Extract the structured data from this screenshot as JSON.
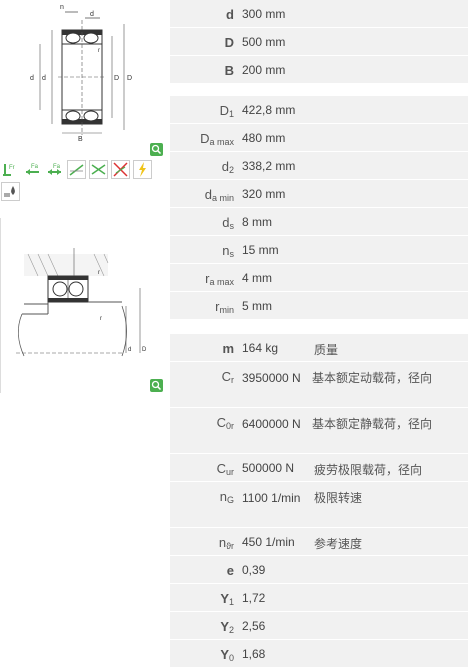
{
  "dimensions": [
    {
      "sym": "d",
      "sub": "",
      "val": "300  mm"
    },
    {
      "sym": "D",
      "sub": "",
      "val": "500  mm"
    },
    {
      "sym": "B",
      "sub": "",
      "val": "200  mm"
    }
  ],
  "mounting": [
    {
      "sym": "D",
      "sub": "1",
      "val": "422,8  mm"
    },
    {
      "sym": "D",
      "sub": "a max",
      "val": "480  mm"
    },
    {
      "sym": "d",
      "sub": "2",
      "val": "338,2  mm"
    },
    {
      "sym": "d",
      "sub": "a min",
      "val": "320  mm"
    },
    {
      "sym": "d",
      "sub": "s",
      "val": "8  mm"
    },
    {
      "sym": "n",
      "sub": "s",
      "val": "15  mm"
    },
    {
      "sym": "r",
      "sub": "a max",
      "val": "4  mm"
    },
    {
      "sym": "r",
      "sub": "min",
      "val": "5  mm"
    }
  ],
  "properties": [
    {
      "sym": "m",
      "sub": "",
      "val": "164  kg",
      "desc": "质量"
    },
    {
      "sym": "C",
      "sub": "r",
      "val": "3950000 N",
      "desc": "基本额定动载荷，径向"
    },
    {
      "sym": "C",
      "sub": "0r",
      "val": "6400000 N",
      "desc": "基本额定静载荷，径向"
    },
    {
      "sym": "C",
      "sub": "ur",
      "val": "500000  N",
      "desc": "疲劳极限载荷，径向"
    },
    {
      "sym": "n",
      "sub": "G",
      "val": "1100  1/min",
      "desc": "极限转速"
    },
    {
      "sym": "n",
      "sub": "ϑr",
      "val": "450  1/min",
      "desc": "参考速度"
    },
    {
      "sym": "e",
      "sub": "",
      "val": "0,39",
      "desc": ""
    },
    {
      "sym": "Y",
      "sub": "1",
      "val": "1,72",
      "desc": ""
    },
    {
      "sym": "Y",
      "sub": "2",
      "val": "2,56",
      "desc": ""
    },
    {
      "sym": "Y",
      "sub": "0",
      "val": "1,68",
      "desc": ""
    }
  ],
  "drawing_labels": {
    "ns": "n",
    "ns_sub": "s",
    "ds": "d",
    "ds_sub": "s",
    "d": "d",
    "d2": "d",
    "d2_sub": "2",
    "D1": "D",
    "D1_sub": "1",
    "D": "D",
    "B": "B",
    "r": "r",
    "ra": "r",
    "ra_sub": "a",
    "da": "d",
    "da_sub": "a",
    "Da": "D",
    "Da_sub": "a"
  },
  "colors": {
    "accent": "#4caf50",
    "panel": "#f1f1f1",
    "line": "#555"
  }
}
